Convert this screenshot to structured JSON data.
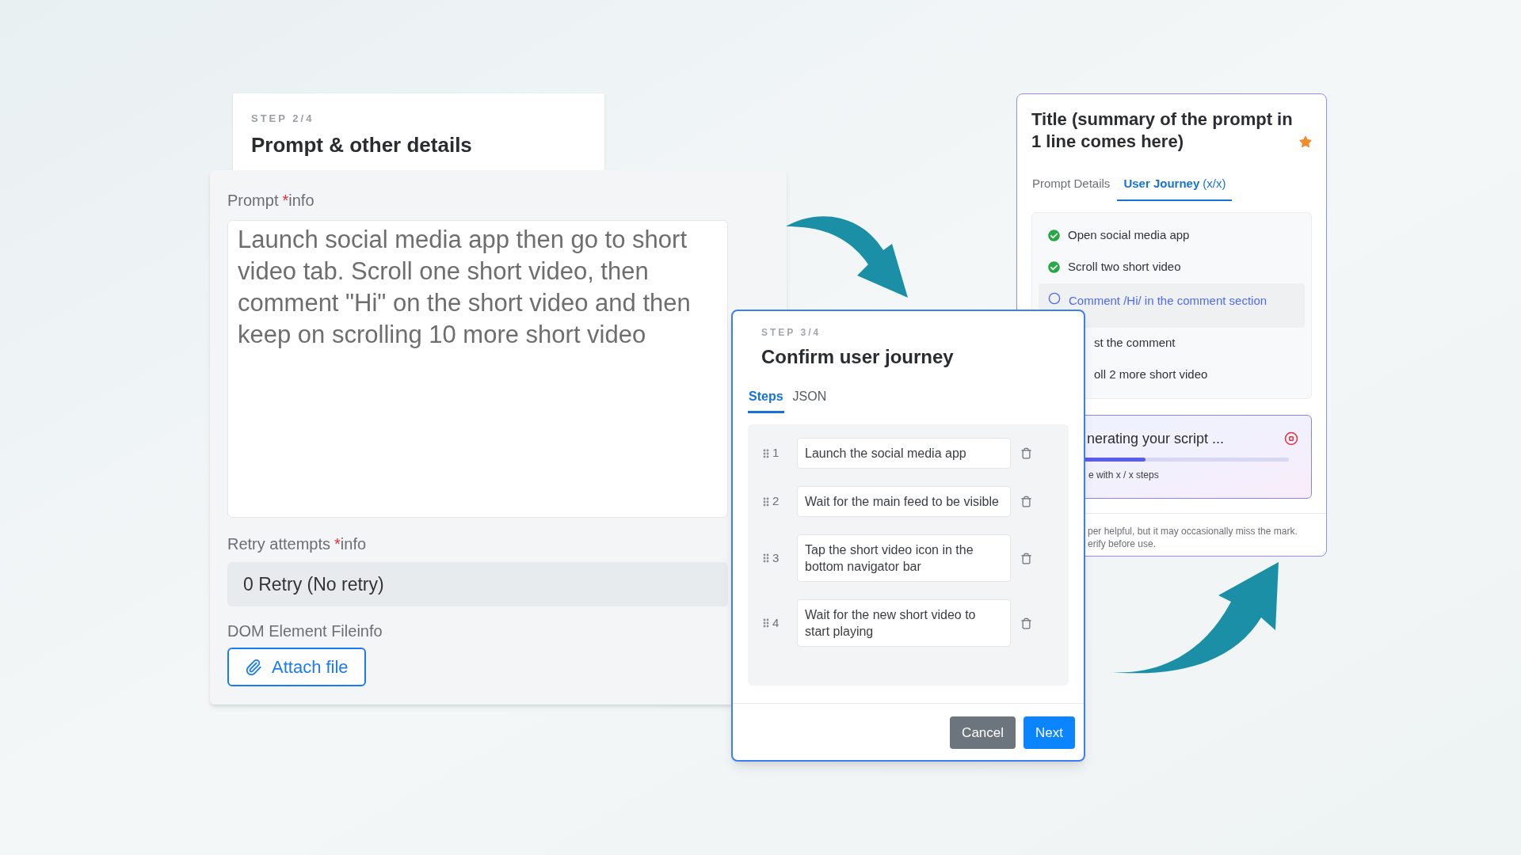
{
  "step_header": {
    "step": "STEP 2/4",
    "title": "Prompt & other details"
  },
  "prompt_form": {
    "fields": [
      {
        "kind": "textarea",
        "label": "Prompt",
        "mark": "*",
        "hint": "info",
        "value": "Launch social media app then go to short video tab. Scroll one short video, then comment \"Hi\" on the short video and then keep on scrolling 10 more short video"
      },
      {
        "kind": "select",
        "label": "Retry attempts",
        "mark": "*",
        "hint": "info",
        "value": "0 Retry (No retry)"
      },
      {
        "kind": "file",
        "label": "DOM Element File",
        "hint": "info",
        "button": "Attach file"
      }
    ]
  },
  "confirm_dialog": {
    "step": "STEP 3/4",
    "title": "Confirm user journey",
    "tabs": [
      {
        "label": "Steps",
        "selected": true
      },
      {
        "label": "JSON",
        "selected": false
      }
    ],
    "steps": [
      {
        "number": "1",
        "text": "Launch the social media app"
      },
      {
        "number": "2",
        "text": "Wait for the main feed to be visible"
      },
      {
        "number": "3",
        "text": "Tap the short video icon in the bottom navigator bar"
      },
      {
        "number": "4",
        "text": "Wait for the new short video to start playing"
      }
    ],
    "buttons": [
      {
        "label": "Cancel",
        "kind": "secondary"
      },
      {
        "label": "Next",
        "kind": "primary"
      }
    ]
  },
  "summary_panel": {
    "title": "Title (summary of the prompt in 1 line comes here)",
    "starred": true,
    "tabs": [
      {
        "label": "Prompt Details",
        "selected": false
      },
      {
        "label": "User Journey",
        "count": "(x/x)",
        "selected": true
      }
    ],
    "journey": [
      {
        "text": "Open social media app",
        "done": true,
        "selected": false
      },
      {
        "text": "Scroll two short video",
        "done": true,
        "selected": false
      },
      {
        "text": "Comment /Hi/ in the comment section",
        "done": false,
        "selected": true
      },
      {
        "text": "st the comment"
      },
      {
        "text": "oll 2 more short video"
      }
    ],
    "progress": {
      "title": "nerating your script ...",
      "level": 0.37,
      "caption": "e with x / x steps"
    },
    "disclaimer_lines": [
      "per helpful, but it may occasionally miss the mark.",
      "erify before use."
    ]
  }
}
